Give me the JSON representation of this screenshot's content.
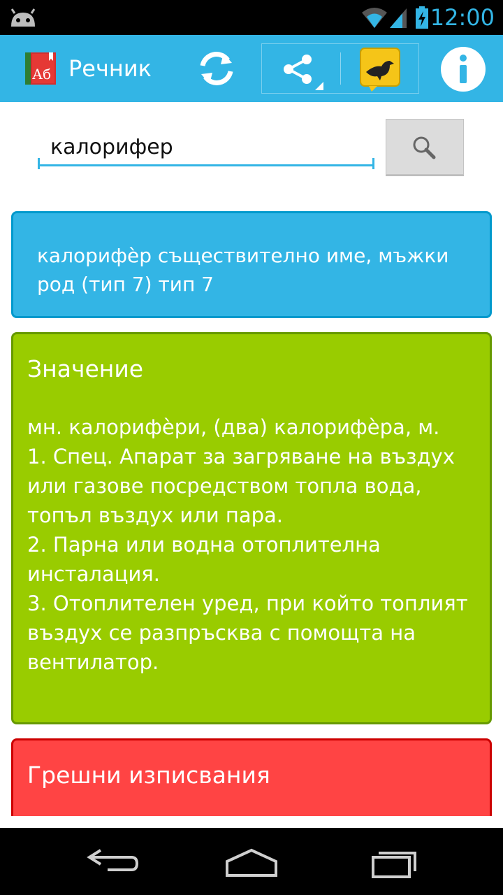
{
  "status_bar": {
    "time": "12:00",
    "clock_color": "#33b5e5"
  },
  "action_bar": {
    "title": "Речник",
    "app_icon_text": "Аб",
    "background": "#33b5e5",
    "icons": [
      "refresh-icon",
      "share-icon",
      "bird-icon",
      "info-icon"
    ]
  },
  "search": {
    "value": "калорифер",
    "button_icon": "search-icon"
  },
  "cards": {
    "summary": {
      "text": "калорифѐр съществително име, мъжки род (тип 7) тип 7",
      "color": "#33b5e5"
    },
    "meaning": {
      "title": "Значение",
      "body": "мн. калорифѐри, (два) калорифѐра, м.\n1. Спец. Апарат за загряване на въздух или газове посредством топла вода, топъл въздух или пара.\n2. Парна или водна отоплителна инсталация.\n3. Отоплителен уред, при който топлият въздух се разпръсква с помощта на вентилатор.",
      "color": "#99cc00"
    },
    "misspellings": {
      "title": "Грешни изписвания",
      "color": "#ff4444"
    }
  },
  "nav_bar": {
    "icons": [
      "back-icon",
      "home-icon",
      "recents-icon"
    ]
  }
}
